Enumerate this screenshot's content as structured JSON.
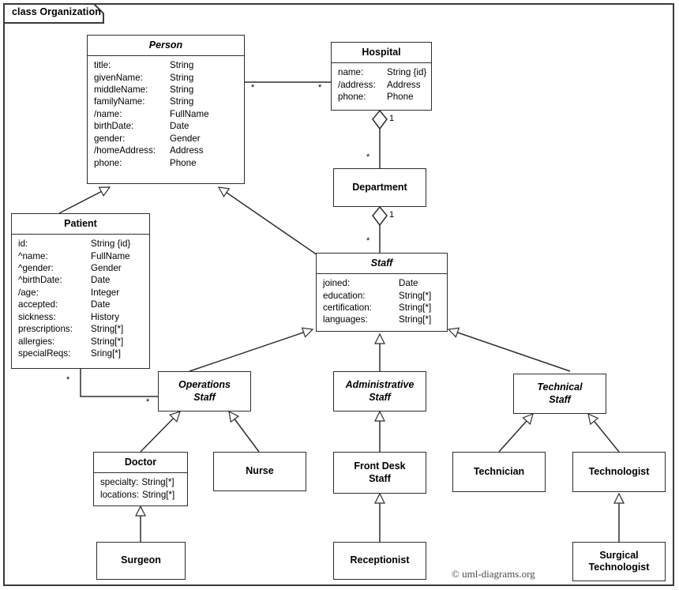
{
  "frame": {
    "label": "class Organization"
  },
  "credit": "© uml-diagrams.org",
  "classes": {
    "person": {
      "name": "Person",
      "attrs": [
        {
          "name": "title:",
          "type": "String"
        },
        {
          "name": "givenName:",
          "type": "String"
        },
        {
          "name": "middleName:",
          "type": "String"
        },
        {
          "name": "familyName:",
          "type": "String"
        },
        {
          "name": "/name:",
          "type": "FullName"
        },
        {
          "name": "birthDate:",
          "type": "Date"
        },
        {
          "name": "gender:",
          "type": "Gender"
        },
        {
          "name": "/homeAddress:",
          "type": "Address"
        },
        {
          "name": "phone:",
          "type": "Phone"
        }
      ]
    },
    "hospital": {
      "name": "Hospital",
      "attrs": [
        {
          "name": "name:",
          "type": "String {id}"
        },
        {
          "name": "/address:",
          "type": "Address"
        },
        {
          "name": "phone:",
          "type": "Phone"
        }
      ]
    },
    "patient": {
      "name": "Patient",
      "attrs": [
        {
          "name": "id:",
          "type": "String {id}"
        },
        {
          "name": "^name:",
          "type": "FullName"
        },
        {
          "name": "^gender:",
          "type": "Gender"
        },
        {
          "name": "^birthDate:",
          "type": "Date"
        },
        {
          "name": "/age:",
          "type": "Integer"
        },
        {
          "name": "accepted:",
          "type": "Date"
        },
        {
          "name": "sickness:",
          "type": "History"
        },
        {
          "name": "prescriptions:",
          "type": "String[*]"
        },
        {
          "name": "allergies:",
          "type": "String[*]"
        },
        {
          "name": "specialReqs:",
          "type": "Sring[*]"
        }
      ]
    },
    "department": {
      "name": "Department",
      "attrs": []
    },
    "staff": {
      "name": "Staff",
      "attrs": [
        {
          "name": "joined:",
          "type": "Date"
        },
        {
          "name": "education:",
          "type": "String[*]"
        },
        {
          "name": "certification:",
          "type": "String[*]"
        },
        {
          "name": "languages:",
          "type": "String[*]"
        }
      ]
    },
    "operations_staff": {
      "name": "Operations\nStaff",
      "attrs": []
    },
    "administrative_staff": {
      "name": "Administrative\nStaff",
      "attrs": []
    },
    "technical_staff": {
      "name": "Technical\nStaff",
      "attrs": []
    },
    "doctor": {
      "name": "Doctor",
      "attrs": [
        {
          "name": "specialty:",
          "type": "String[*]"
        },
        {
          "name": "locations:",
          "type": "String[*]"
        }
      ]
    },
    "nurse": {
      "name": "Nurse",
      "attrs": []
    },
    "front_desk_staff": {
      "name": "Front Desk\nStaff",
      "attrs": []
    },
    "technician": {
      "name": "Technician",
      "attrs": []
    },
    "technologist": {
      "name": "Technologist",
      "attrs": []
    },
    "surgeon": {
      "name": "Surgeon",
      "attrs": []
    },
    "receptionist": {
      "name": "Receptionist",
      "attrs": []
    },
    "surgical_technologist": {
      "name": "Surgical\nTechnologist",
      "attrs": []
    }
  },
  "multiplicities": {
    "person_hospital_person_end": "*",
    "person_hospital_hospital_end": "*",
    "hospital_department_hospital_end": "1",
    "hospital_department_department_end": "*",
    "department_staff_department_end": "1",
    "department_staff_staff_end": "*",
    "patient_ops_patient_end": "*",
    "patient_ops_ops_end": "*"
  },
  "colors": {
    "line": "#2e2e2e",
    "frame": "#3a3a3a",
    "background": "#ffffff",
    "text": "#000000",
    "credit": "#4b4b4b"
  }
}
